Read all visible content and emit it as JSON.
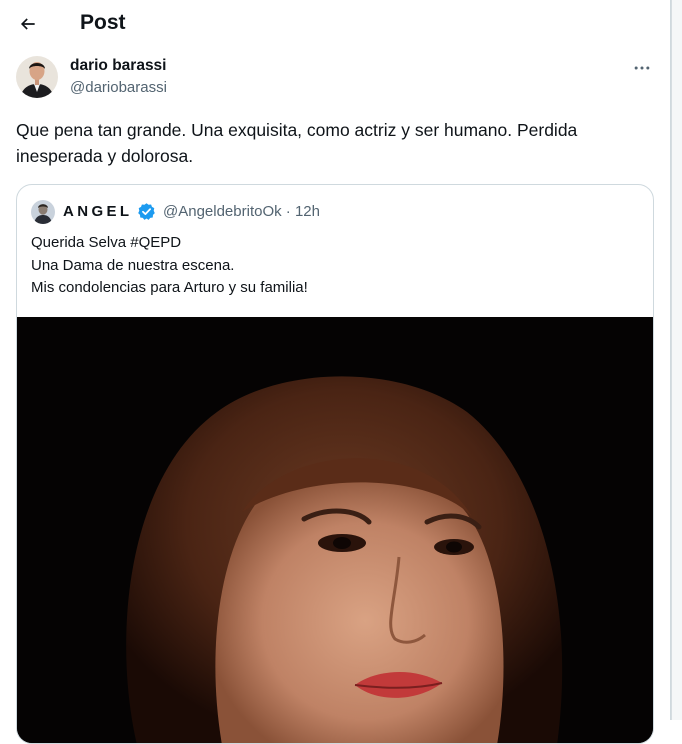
{
  "header": {
    "title": "Post",
    "back_icon": "arrow-left-icon"
  },
  "post": {
    "author_name": "dario barassi",
    "author_handle": "@dariobarassi",
    "more_icon": "more-horizontal-icon",
    "text": "Que pena tan grande. Una exquisita, como actriz y ser humano. Perdida inesperada y dolorosa."
  },
  "quoted_post": {
    "author_name": "ANGEL",
    "verified_icon": "verified-badge-icon",
    "verified_color": "#1d9bf0",
    "author_handle": "@AngeldebritoOk",
    "separator": "·",
    "time": "12h",
    "lines": [
      "Querida Selva #QEPD",
      "Una Dama de nuestra escena.",
      "Mis condolencias para Arturo y su familia!"
    ],
    "media": "portrait-photo"
  },
  "colors": {
    "text_primary": "#0f1419",
    "text_secondary": "#536471",
    "border": "#cfd9de"
  }
}
